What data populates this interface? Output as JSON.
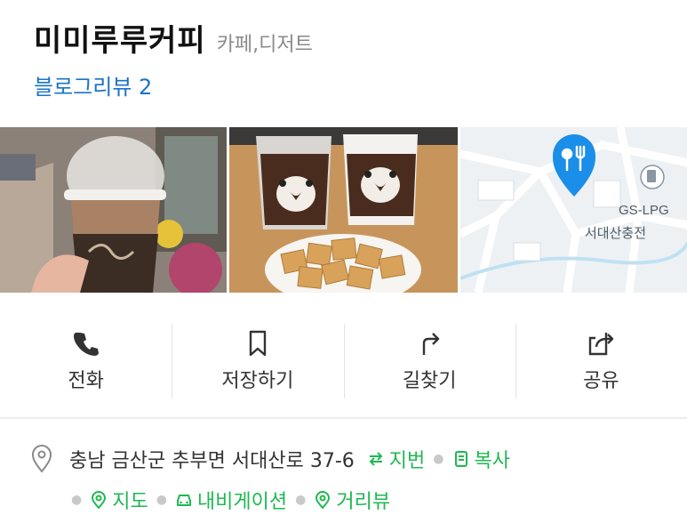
{
  "place": {
    "name": "미미루루커피",
    "category": "카페,디저트",
    "blog_review": "블로그리뷰 2"
  },
  "photos": [
    {
      "icon": "photo-iced-coffee"
    },
    {
      "icon": "photo-coffee-cups-crackers"
    },
    {
      "icon": "photo-map-thumbnail",
      "map_label_1": "GS-LPG",
      "map_label_2": "서대산충전"
    }
  ],
  "actions": [
    {
      "label": "전화",
      "icon": "phone-icon"
    },
    {
      "label": "저장하기",
      "icon": "bookmark-icon"
    },
    {
      "label": "길찾기",
      "icon": "directions-icon"
    },
    {
      "label": "공유",
      "icon": "share-icon"
    }
  ],
  "address": {
    "text": "충남 금산군 추부면 서대산로 37-6",
    "jibun": "지번",
    "copy": "복사",
    "map": "지도",
    "navigation": "내비게이션",
    "street_view": "거리뷰"
  },
  "colors": {
    "link_blue": "#1a73c6",
    "accent_green": "#1eb850",
    "map_pin_blue": "#1a8ee8"
  }
}
